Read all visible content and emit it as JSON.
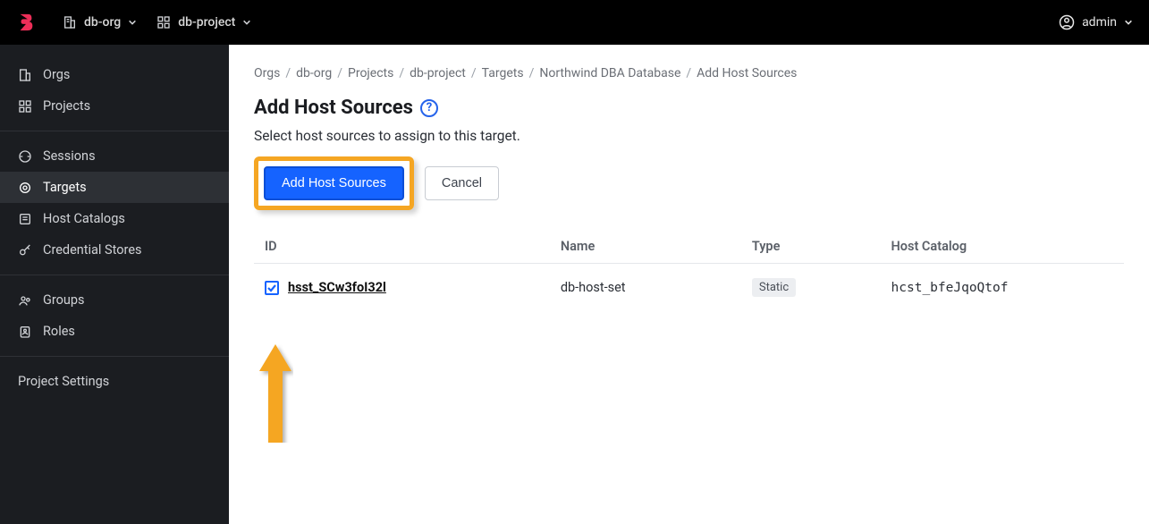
{
  "topbar": {
    "org": "db-org",
    "project": "db-project",
    "user": "admin"
  },
  "sidebar": {
    "group1": [
      {
        "label": "Orgs",
        "icon": "building"
      },
      {
        "label": "Projects",
        "icon": "grid"
      }
    ],
    "group2": [
      {
        "label": "Sessions",
        "icon": "sessions"
      },
      {
        "label": "Targets",
        "icon": "target",
        "active": true
      },
      {
        "label": "Host Catalogs",
        "icon": "catalog"
      },
      {
        "label": "Credential Stores",
        "icon": "key"
      }
    ],
    "group3": [
      {
        "label": "Groups",
        "icon": "groups"
      },
      {
        "label": "Roles",
        "icon": "roles"
      }
    ],
    "group4": [
      {
        "label": "Project Settings"
      }
    ]
  },
  "breadcrumb": [
    "Orgs",
    "db-org",
    "Projects",
    "db-project",
    "Targets",
    "Northwind DBA Database",
    "Add Host Sources"
  ],
  "page": {
    "title": "Add Host Sources",
    "description": "Select host sources to assign to this target.",
    "primary_button": "Add Host Sources",
    "cancel_button": "Cancel"
  },
  "table": {
    "headers": {
      "id": "ID",
      "name": "Name",
      "type": "Type",
      "catalog": "Host Catalog"
    },
    "rows": [
      {
        "checked": true,
        "id": "hsst_SCw3foI32l",
        "name": "db-host-set",
        "type": "Static",
        "catalog": "hcst_bfeJqoQtof"
      }
    ]
  }
}
